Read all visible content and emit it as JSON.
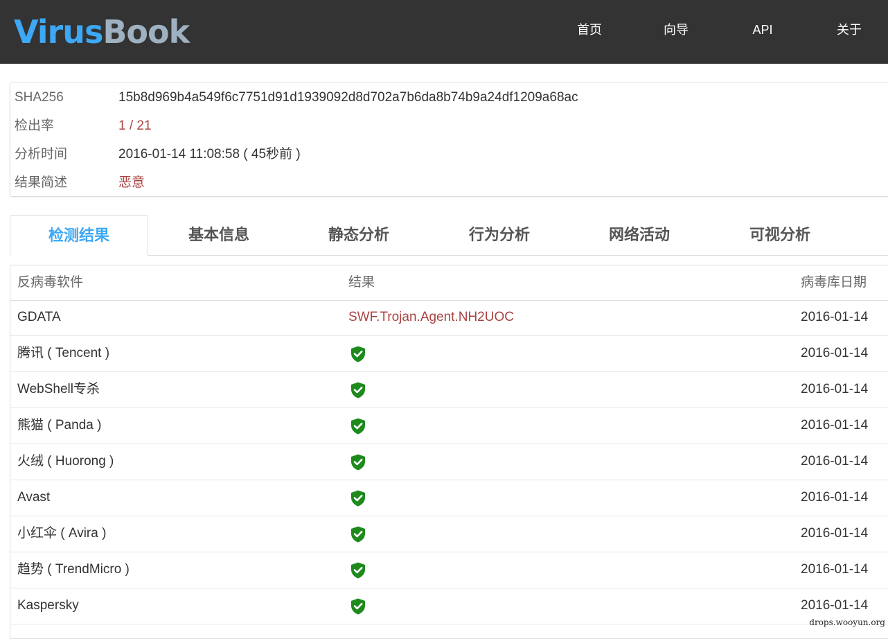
{
  "app": {
    "logo_part1": "Virus",
    "logo_part2": "Book"
  },
  "nav": {
    "items": [
      {
        "label": "首页"
      },
      {
        "label": "向导"
      },
      {
        "label": "API"
      },
      {
        "label": "关于"
      }
    ]
  },
  "summary": {
    "sha_label": "SHA256",
    "sha_value": "15b8d969b4a549f6c7751d91d1939092d8d702a7b6da8b74b9a24df1209a68ac",
    "rate_label": "检出率",
    "rate_value": "1 / 21",
    "time_label": "分析时间",
    "time_value": "2016-01-14 11:08:58 ( 45秒前 )",
    "result_label": "结果简述",
    "result_value": "恶意"
  },
  "tabs": [
    {
      "label": "检测结果",
      "active": true
    },
    {
      "label": "基本信息"
    },
    {
      "label": "静态分析"
    },
    {
      "label": "行为分析"
    },
    {
      "label": "网络活动"
    },
    {
      "label": "可视分析"
    }
  ],
  "table": {
    "headers": {
      "engine": "反病毒软件",
      "result": "结果",
      "date": "病毒库日期"
    },
    "rows": [
      {
        "engine": "GDATA",
        "result": "SWF.Trojan.Agent.NH2UOC",
        "status": "detected",
        "date": "2016-01-14"
      },
      {
        "engine": "腾讯 ( Tencent )",
        "result": "",
        "status": "clean",
        "date": "2016-01-14"
      },
      {
        "engine": "WebShell专杀",
        "result": "",
        "status": "clean",
        "date": "2016-01-14"
      },
      {
        "engine": "熊猫 ( Panda )",
        "result": "",
        "status": "clean",
        "date": "2016-01-14"
      },
      {
        "engine": "火绒 ( Huorong )",
        "result": "",
        "status": "clean",
        "date": "2016-01-14"
      },
      {
        "engine": "Avast",
        "result": "",
        "status": "clean",
        "date": "2016-01-14"
      },
      {
        "engine": "小红伞 ( Avira )",
        "result": "",
        "status": "clean",
        "date": "2016-01-14"
      },
      {
        "engine": "趋势 ( TrendMicro )",
        "result": "",
        "status": "clean",
        "date": "2016-01-14"
      },
      {
        "engine": "Kaspersky",
        "result": "",
        "status": "clean",
        "date": "2016-01-14"
      }
    ]
  },
  "icons": {
    "clean": "shield-check-icon"
  },
  "colors": {
    "accent": "#3da8f5",
    "malicious": "#a94442",
    "clean": "#1e8a1e",
    "navbar": "#333333"
  },
  "watermark": "drops.wooyun.org"
}
